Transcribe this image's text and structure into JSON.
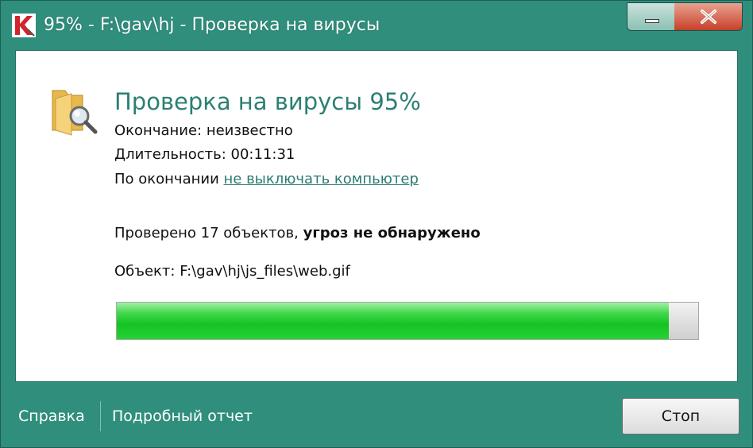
{
  "window": {
    "title": "95% - F:\\gav\\hj - Проверка на вирусы",
    "accent_color": "#2f8f7c",
    "minimize_icon": "minimize-icon",
    "close_icon": "close-icon"
  },
  "scan": {
    "heading": "Проверка на вирусы 95%",
    "end_label": "Окончание:",
    "end_value": "неизвестно",
    "duration_label": "Длительность:",
    "duration_value": "00:11:31",
    "on_finish_label": "По окончании",
    "on_finish_link": "не выключать компьютер",
    "checked_text": "Проверено 17 объектов,",
    "threats_text": "угроз не обнаружено",
    "object_label": "Объект:",
    "object_path": "F:\\gav\\hj\\js_files\\web.gif",
    "progress_fraction": 0.95,
    "progress_color": "#14c322",
    "icon": "folder-search-icon"
  },
  "footer": {
    "help_label": "Справка",
    "report_label": "Подробный отчет",
    "stop_label": "Стоп"
  }
}
